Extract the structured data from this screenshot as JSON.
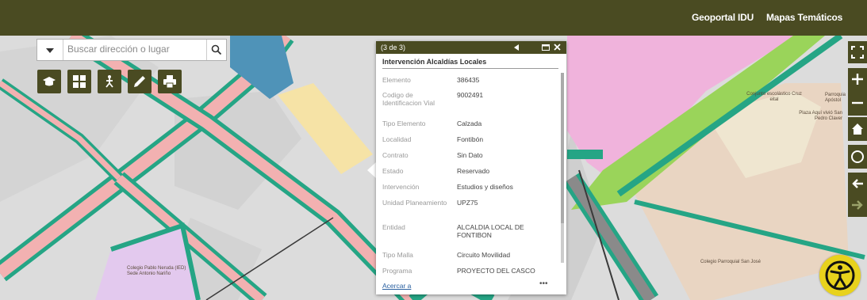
{
  "header": {
    "links": [
      "Geoportal IDU",
      "Mapas Temáticos"
    ]
  },
  "search": {
    "placeholder": "Buscar dirección o lugar"
  },
  "toolbar": {
    "tools": [
      "graduation-cap-icon",
      "grid-icon",
      "person-route-icon",
      "pencil-icon",
      "printer-icon"
    ]
  },
  "map_labels": {
    "school_1": "Conjunto escolástico Cruz eital",
    "parish_1": "Parroquia Apóstol",
    "church": "Plaza Aquí vivió San Pedro Claver",
    "school_2": "Colegio Parroquial San José",
    "school_3": "Colegio Pablo Neruda (IED) Sede Antonio Nariño"
  },
  "popup": {
    "counter": "(3 de 3)",
    "title": "Intervención Alcaldías Locales",
    "fields": [
      {
        "key": "Elemento",
        "value": "386435"
      },
      {
        "key": "Codigo de Identificacion Vial",
        "value": "9002491"
      },
      {
        "key": "Tipo Elemento",
        "value": "Calzada"
      },
      {
        "key": "Localidad",
        "value": "Fontibón"
      },
      {
        "key": "Contrato",
        "value": "Sin Dato"
      },
      {
        "key": "Estado",
        "value": "Reservado"
      },
      {
        "key": "Intervención",
        "value": "Estudios y diseños"
      },
      {
        "key": "Unidad Planeamiento",
        "value": "UPZ75"
      },
      {
        "key": "Entidad",
        "value": "ALCALDIA LOCAL DE FONTIBON"
      },
      {
        "key": "Tipo Malla",
        "value": "Circuito Movilidad"
      },
      {
        "key": "Programa",
        "value": "PROYECTO DEL CASCO"
      }
    ],
    "zoom_link": "Acercar a",
    "more": "•••"
  },
  "colors": {
    "header": "#4a4b22",
    "road_green": "#25a585",
    "road_pink": "#f2b1b1",
    "zone_pink": "#f0b3dc",
    "zone_tan": "#e9d5c2",
    "lime": "#9ad45a",
    "accessibility": "#e8d21c"
  }
}
